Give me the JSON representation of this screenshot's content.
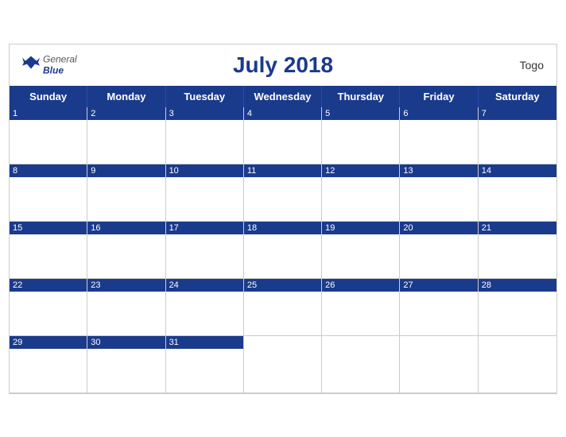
{
  "header": {
    "title": "July 2018",
    "country": "Togo",
    "logo_general": "General",
    "logo_blue": "Blue"
  },
  "days_of_week": [
    "Sunday",
    "Monday",
    "Tuesday",
    "Wednesday",
    "Thursday",
    "Friday",
    "Saturday"
  ],
  "weeks": [
    [
      {
        "num": "1"
      },
      {
        "num": "2"
      },
      {
        "num": "3"
      },
      {
        "num": "4"
      },
      {
        "num": "5"
      },
      {
        "num": "6"
      },
      {
        "num": "7"
      }
    ],
    [
      {
        "num": "8"
      },
      {
        "num": "9"
      },
      {
        "num": "10"
      },
      {
        "num": "11"
      },
      {
        "num": "12"
      },
      {
        "num": "13"
      },
      {
        "num": "14"
      }
    ],
    [
      {
        "num": "15"
      },
      {
        "num": "16"
      },
      {
        "num": "17"
      },
      {
        "num": "18"
      },
      {
        "num": "19"
      },
      {
        "num": "20"
      },
      {
        "num": "21"
      }
    ],
    [
      {
        "num": "22"
      },
      {
        "num": "23"
      },
      {
        "num": "24"
      },
      {
        "num": "25"
      },
      {
        "num": "26"
      },
      {
        "num": "27"
      },
      {
        "num": "28"
      }
    ],
    [
      {
        "num": "29"
      },
      {
        "num": "30"
      },
      {
        "num": "31"
      },
      {
        "num": ""
      },
      {
        "num": ""
      },
      {
        "num": ""
      },
      {
        "num": ""
      }
    ]
  ],
  "colors": {
    "header_blue": "#1a3a8c",
    "border": "#cccccc"
  }
}
